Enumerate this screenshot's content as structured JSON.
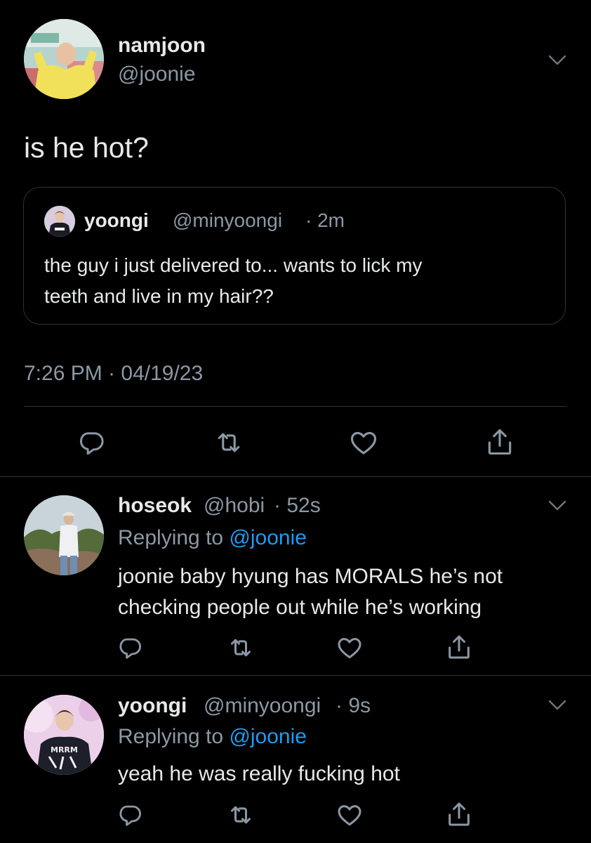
{
  "main_tweet": {
    "display_name": "namjoon",
    "handle": "@joonie",
    "text": "is he hot?",
    "timestamp": "7:26 PM · 04/19/23",
    "quote": {
      "display_name": "yoongi",
      "handle": "@minyoongi",
      "age": "· 2m",
      "text_lines": [
        "the guy i just delivered to... wants to lick my",
        "teeth and live in my hair??"
      ]
    }
  },
  "replies": [
    {
      "display_name": "hoseok",
      "handle": "@hobi",
      "age": "· 52s",
      "replying_prefix": "Replying to ",
      "replying_to": "@joonie",
      "text_lines": [
        "joonie baby hyung has MORALS he’s not",
        "checking people out while he’s working"
      ]
    },
    {
      "display_name": "yoongi",
      "handle": "@minyoongi",
      "age": "· 9s",
      "replying_prefix": "Replying to ",
      "replying_to": "@joonie",
      "text_lines": [
        "yeah he was really fucking hot"
      ]
    }
  ],
  "icons": {
    "reply": "reply-icon",
    "retweet": "retweet-icon",
    "like": "heart-icon",
    "share": "share-icon",
    "more": "chevron-down-icon"
  },
  "colors": {
    "background": "#000000",
    "text": "#e7e9ea",
    "muted": "#8b98a5",
    "link": "#1d9bf0",
    "divider": "#2f3336"
  }
}
